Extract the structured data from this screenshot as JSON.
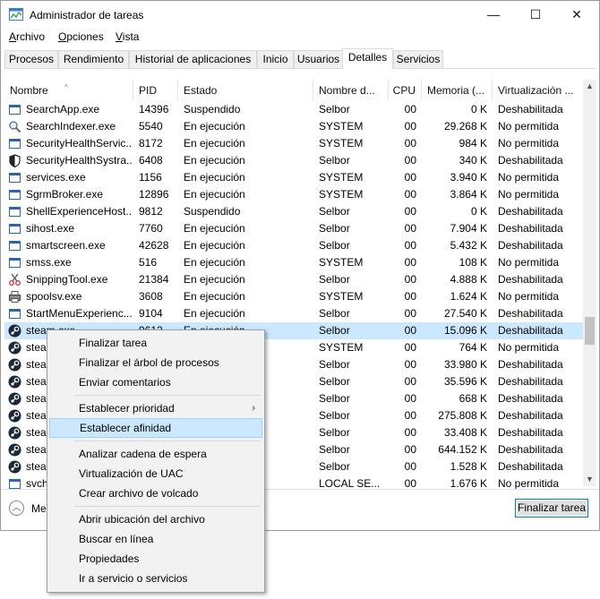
{
  "window": {
    "title": "Administrador de tareas",
    "minimize": "—",
    "maximize": "☐",
    "close": "✕"
  },
  "menubar": [
    {
      "label": "Archivo",
      "key": "A",
      "rest": "rchivo"
    },
    {
      "label": "Opciones",
      "key": "O",
      "rest": "pciones"
    },
    {
      "label": "Vista",
      "key": "V",
      "rest": "ista"
    }
  ],
  "tabs": [
    "Procesos",
    "Rendimiento",
    "Historial de aplicaciones",
    "Inicio",
    "Usuarios",
    "Detalles",
    "Servicios"
  ],
  "active_tab": "Detalles",
  "columns": [
    "Nombre",
    "PID",
    "Estado",
    "Nombre d...",
    "CPU",
    "Memoria (...",
    "Virtualización ..."
  ],
  "rows": [
    {
      "name": "SearchApp.exe",
      "pid": "14396",
      "status": "Suspendido",
      "user": "Selbor",
      "cpu": "00",
      "mem": "0 K",
      "virt": "Deshabilitada",
      "icon": "app-icon"
    },
    {
      "name": "SearchIndexer.exe",
      "pid": "5540",
      "status": "En ejecución",
      "user": "SYSTEM",
      "cpu": "00",
      "mem": "29.268 K",
      "virt": "No permitida",
      "icon": "search-indexer-icon"
    },
    {
      "name": "SecurityHealthServic...",
      "pid": "8172",
      "status": "En ejecución",
      "user": "SYSTEM",
      "cpu": "00",
      "mem": "984 K",
      "virt": "No permitida",
      "icon": "app-icon"
    },
    {
      "name": "SecurityHealthSystra...",
      "pid": "6408",
      "status": "En ejecución",
      "user": "Selbor",
      "cpu": "00",
      "mem": "340 K",
      "virt": "Deshabilitada",
      "icon": "shield-icon"
    },
    {
      "name": "services.exe",
      "pid": "1156",
      "status": "En ejecución",
      "user": "SYSTEM",
      "cpu": "00",
      "mem": "3.940 K",
      "virt": "No permitida",
      "icon": "app-icon"
    },
    {
      "name": "SgrmBroker.exe",
      "pid": "12896",
      "status": "En ejecución",
      "user": "SYSTEM",
      "cpu": "00",
      "mem": "3.864 K",
      "virt": "No permitida",
      "icon": "app-icon"
    },
    {
      "name": "ShellExperienceHost....",
      "pid": "9812",
      "status": "Suspendido",
      "user": "Selbor",
      "cpu": "00",
      "mem": "0 K",
      "virt": "Deshabilitada",
      "icon": "app-icon"
    },
    {
      "name": "sihost.exe",
      "pid": "7760",
      "status": "En ejecución",
      "user": "Selbor",
      "cpu": "00",
      "mem": "7.904 K",
      "virt": "Deshabilitada",
      "icon": "app-icon"
    },
    {
      "name": "smartscreen.exe",
      "pid": "42628",
      "status": "En ejecución",
      "user": "Selbor",
      "cpu": "00",
      "mem": "5.432 K",
      "virt": "Deshabilitada",
      "icon": "app-icon"
    },
    {
      "name": "smss.exe",
      "pid": "516",
      "status": "En ejecución",
      "user": "SYSTEM",
      "cpu": "00",
      "mem": "108 K",
      "virt": "No permitida",
      "icon": "app-icon"
    },
    {
      "name": "SnippingTool.exe",
      "pid": "21384",
      "status": "En ejecución",
      "user": "Selbor",
      "cpu": "00",
      "mem": "4.888 K",
      "virt": "Deshabilitada",
      "icon": "scissors-icon"
    },
    {
      "name": "spoolsv.exe",
      "pid": "3608",
      "status": "En ejecución",
      "user": "SYSTEM",
      "cpu": "00",
      "mem": "1.624 K",
      "virt": "No permitida",
      "icon": "printer-icon"
    },
    {
      "name": "StartMenuExperienc...",
      "pid": "9104",
      "status": "En ejecución",
      "user": "Selbor",
      "cpu": "00",
      "mem": "27.540 K",
      "virt": "Deshabilitada",
      "icon": "app-icon"
    },
    {
      "name": "steam.exe",
      "pid": "9612",
      "status": "En ejecución",
      "user": "Selbor",
      "cpu": "00",
      "mem": "15.096 K",
      "virt": "Deshabilitada",
      "icon": "steam-icon",
      "selected": true
    },
    {
      "name": "steam...",
      "pid": "",
      "status": "",
      "user": "SYSTEM",
      "cpu": "00",
      "mem": "764 K",
      "virt": "No permitida",
      "icon": "steam-icon"
    },
    {
      "name": "steam...",
      "pid": "",
      "status": "",
      "user": "Selbor",
      "cpu": "00",
      "mem": "33.980 K",
      "virt": "Deshabilitada",
      "icon": "steam-icon"
    },
    {
      "name": "steam...",
      "pid": "",
      "status": "",
      "user": "Selbor",
      "cpu": "00",
      "mem": "35.596 K",
      "virt": "Deshabilitada",
      "icon": "steam-icon"
    },
    {
      "name": "steam...",
      "pid": "",
      "status": "",
      "user": "Selbor",
      "cpu": "00",
      "mem": "668 K",
      "virt": "Deshabilitada",
      "icon": "steam-icon"
    },
    {
      "name": "steam...",
      "pid": "",
      "status": "",
      "user": "Selbor",
      "cpu": "00",
      "mem": "275.808 K",
      "virt": "Deshabilitada",
      "icon": "steam-icon"
    },
    {
      "name": "steam...",
      "pid": "",
      "status": "",
      "user": "Selbor",
      "cpu": "00",
      "mem": "33.408 K",
      "virt": "Deshabilitada",
      "icon": "steam-icon"
    },
    {
      "name": "steam...",
      "pid": "",
      "status": "",
      "user": "Selbor",
      "cpu": "00",
      "mem": "644.152 K",
      "virt": "Deshabilitada",
      "icon": "steam-icon"
    },
    {
      "name": "steam...",
      "pid": "",
      "status": "",
      "user": "Selbor",
      "cpu": "00",
      "mem": "1.528 K",
      "virt": "Deshabilitada",
      "icon": "steam-icon"
    },
    {
      "name": "svcho...",
      "pid": "",
      "status": "",
      "user": "LOCAL SE...",
      "cpu": "00",
      "mem": "1.676 K",
      "virt": "No permitida",
      "icon": "app-icon"
    }
  ],
  "footer": {
    "less_details": "Me",
    "end_task": "Finalizar tarea"
  },
  "context_menu": [
    {
      "label": "Finalizar tarea"
    },
    {
      "label": "Finalizar el árbol de procesos"
    },
    {
      "label": "Enviar comentarios"
    },
    {
      "sep": true
    },
    {
      "label": "Establecer prioridad",
      "submenu": true
    },
    {
      "label": "Establecer afinidad",
      "highlighted": true
    },
    {
      "sep": true
    },
    {
      "label": "Analizar cadena de espera"
    },
    {
      "label": "Virtualización de UAC"
    },
    {
      "label": "Crear archivo de volcado"
    },
    {
      "sep": true
    },
    {
      "label": "Abrir ubicación del archivo"
    },
    {
      "label": "Buscar en línea"
    },
    {
      "label": "Propiedades"
    },
    {
      "label": "Ir a servicio o servicios"
    }
  ],
  "colors": {
    "selection": "#cce8ff",
    "accent": "#0078d7",
    "steam": "#1b2838"
  }
}
